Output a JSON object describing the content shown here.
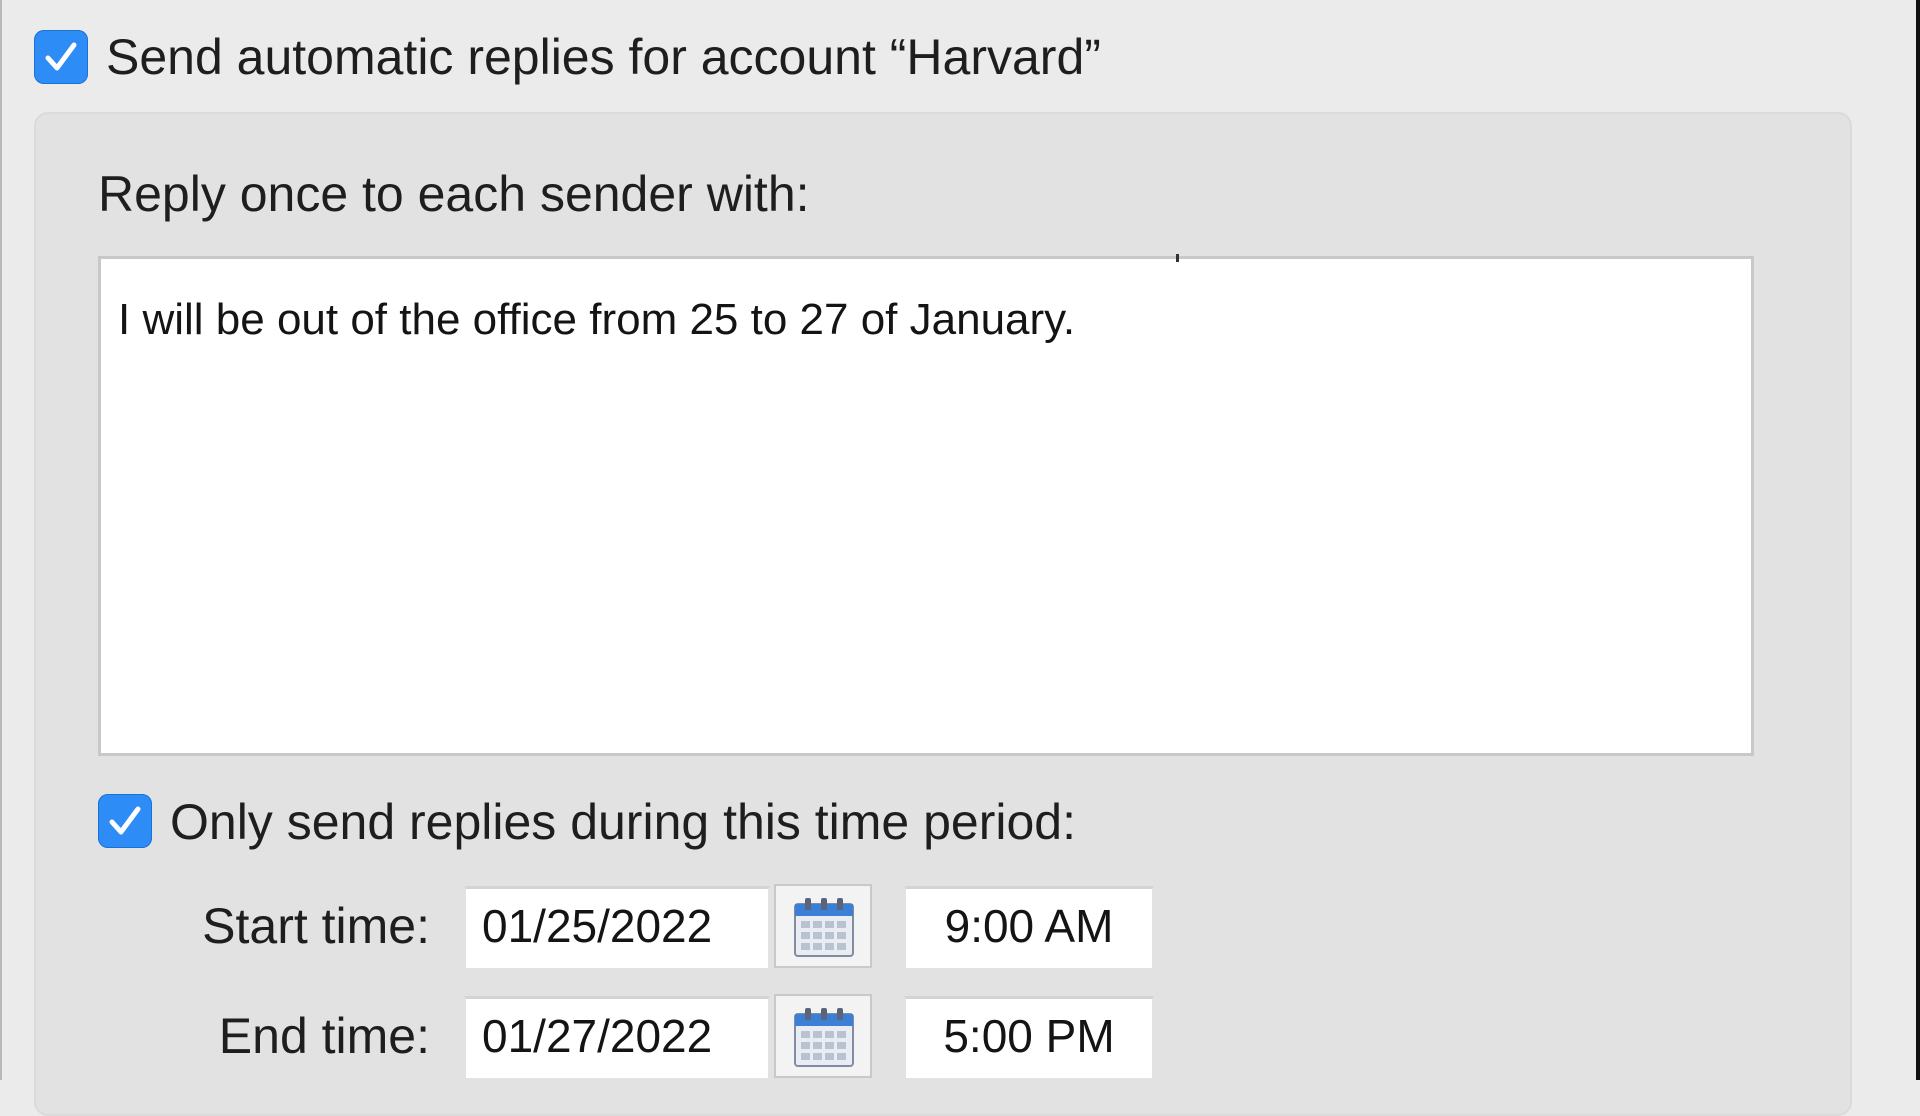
{
  "auto_reply": {
    "enabled_label": "Send automatic replies for account “Harvard”",
    "enabled": true
  },
  "reply": {
    "label": "Reply once to each sender with:",
    "message": "I will be out of the office from 25 to 27 of January."
  },
  "period": {
    "label": "Only send replies during this time period:",
    "enabled": true,
    "start_label": "Start time:",
    "start_date": "01/25/2022",
    "start_time": "9:00 AM",
    "end_label": "End time:",
    "end_date": "01/27/2022",
    "end_time": "5:00 PM"
  },
  "colors": {
    "checkbox_accent": "#2d8cf5",
    "panel_bg": "#e2e2e2",
    "window_bg": "#ebebeb"
  },
  "icons": {
    "checkbox": "checkmark-icon",
    "date_picker": "calendar-icon"
  }
}
